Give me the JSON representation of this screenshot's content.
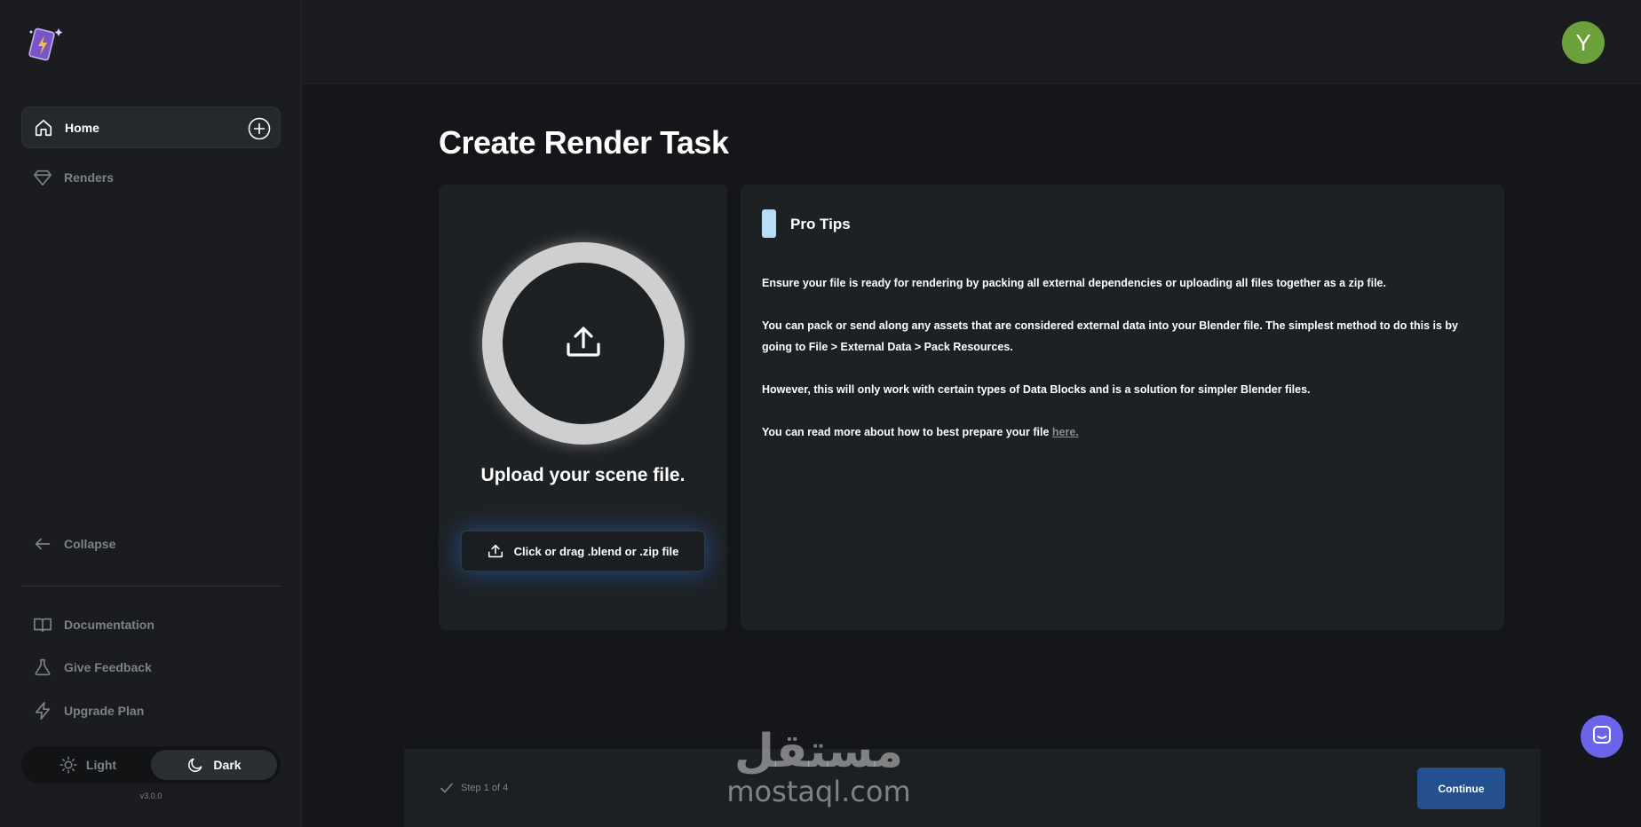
{
  "sidebar": {
    "items": [
      {
        "label": "Home"
      },
      {
        "label": "Renders"
      }
    ],
    "collapse_label": "Collapse",
    "footer_items": [
      {
        "label": "Documentation"
      },
      {
        "label": "Give Feedback"
      },
      {
        "label": "Upgrade Plan"
      }
    ],
    "theme": {
      "light_label": "Light",
      "dark_label": "Dark",
      "selected": "Dark"
    },
    "version": "v3.0.0"
  },
  "header": {
    "avatar_initial": "Y",
    "avatar_color": "#6ba03a"
  },
  "main": {
    "title": "Create Render Task",
    "upload": {
      "title": "Upload your scene file.",
      "button_label": "Click or drag .blend or .zip file"
    },
    "tips": {
      "title": "Pro Tips",
      "paragraphs": [
        "Ensure your file is ready for rendering by packing all external dependencies or uploading all files together as a zip file.",
        "You can pack or send along any assets that are considered external data into your Blender file. The simplest method to do this is by going to File > External Data > Pack Resources.",
        "However, this will only work with certain types of Data Blocks and is a solution for simpler Blender files."
      ],
      "last_paragraph_prefix": "You can read more about how to best prepare your file ",
      "link_text": "here."
    }
  },
  "footer": {
    "step_label": "Step 1 of 4",
    "continue_label": "Continue"
  },
  "watermark": {
    "arabic": "مستقل",
    "latin": "mostaql.com"
  },
  "colors": {
    "accent": "#24508f",
    "tips_marker": "#b7def5",
    "chat": "#6b64ea"
  }
}
